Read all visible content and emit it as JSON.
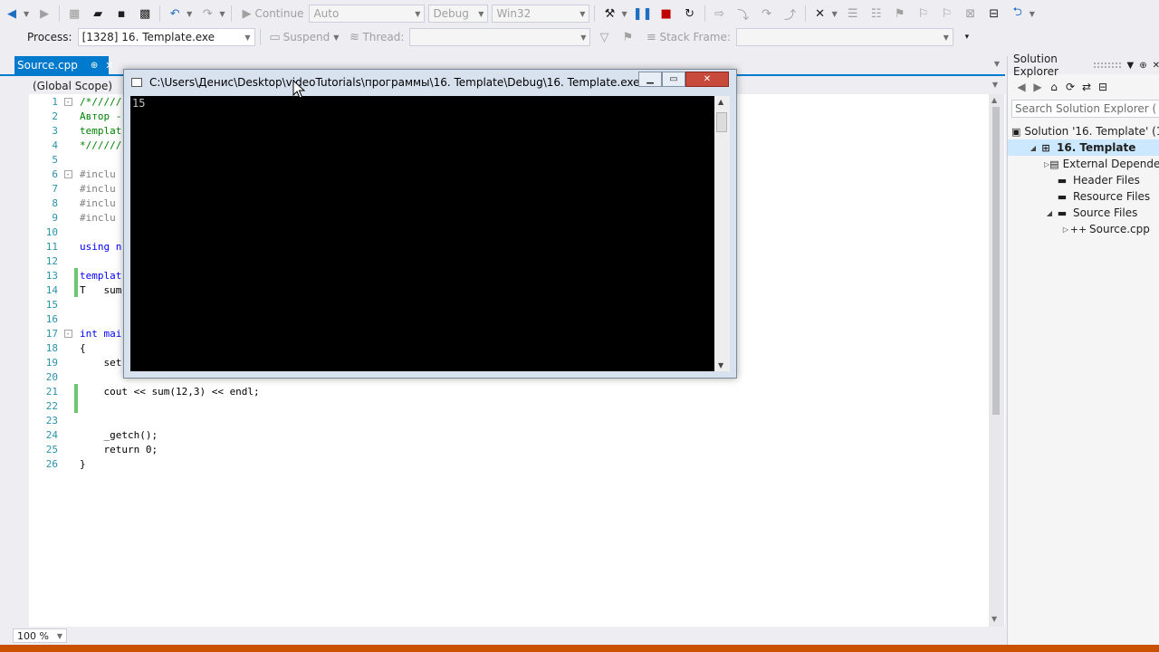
{
  "toolbar": {
    "continue_label": "Continue",
    "solution_config_value": "Auto",
    "build_config_value": "Debug",
    "platform_value": "Win32"
  },
  "debug_toolbar": {
    "process_label": "Process:",
    "process_value": "[1328] 16. Template.exe",
    "suspend_label": "Suspend",
    "thread_label": "Thread:",
    "stack_frame_label": "Stack Frame:"
  },
  "editor": {
    "tab_label": "Source.cpp",
    "scope_label": "(Global Scope)",
    "zoom_level": "100 %",
    "lines": [
      {
        "num": "1",
        "text": "/*/////",
        "cls": "comment",
        "fold": "-"
      },
      {
        "num": "2",
        "text": "Автор -",
        "cls": "comment",
        "fold": ""
      },
      {
        "num": "3",
        "text": "templat",
        "cls": "comment",
        "fold": ""
      },
      {
        "num": "4",
        "text": "*//////",
        "cls": "comment",
        "fold": ""
      },
      {
        "num": "5",
        "text": "",
        "cls": "",
        "fold": ""
      },
      {
        "num": "6",
        "text": "#inclu",
        "cls": "pre",
        "fold": "-"
      },
      {
        "num": "7",
        "text": "#inclu",
        "cls": "pre",
        "fold": ""
      },
      {
        "num": "8",
        "text": "#inclu",
        "cls": "pre",
        "fold": ""
      },
      {
        "num": "9",
        "text": "#inclu",
        "cls": "pre",
        "fold": ""
      },
      {
        "num": "10",
        "text": "",
        "cls": "",
        "fold": ""
      },
      {
        "num": "11",
        "text": "using n",
        "cls": "kw",
        "fold": ""
      },
      {
        "num": "12",
        "text": "",
        "cls": "",
        "fold": ""
      },
      {
        "num": "13",
        "text": "templat",
        "cls": "kw",
        "fold": ""
      },
      {
        "num": "14",
        "text": "T   sum",
        "cls": "",
        "fold": ""
      },
      {
        "num": "15",
        "text": "",
        "cls": "",
        "fold": ""
      },
      {
        "num": "16",
        "text": "",
        "cls": "",
        "fold": ""
      },
      {
        "num": "17",
        "text": "int mai",
        "cls": "kw",
        "fold": "-"
      },
      {
        "num": "18",
        "text": "{",
        "cls": "",
        "fold": ""
      },
      {
        "num": "19",
        "text": "    set",
        "cls": "",
        "fold": ""
      },
      {
        "num": "20",
        "text": "",
        "cls": "",
        "fold": ""
      },
      {
        "num": "21",
        "text": "    cout << sum(12,3) << endl;",
        "cls": "",
        "fold": ""
      },
      {
        "num": "22",
        "text": "",
        "cls": "",
        "fold": ""
      },
      {
        "num": "23",
        "text": "",
        "cls": "",
        "fold": ""
      },
      {
        "num": "24",
        "text": "    _getch();",
        "cls": "",
        "fold": ""
      },
      {
        "num": "25",
        "text": "    return 0;",
        "cls": "",
        "fold": ""
      },
      {
        "num": "26",
        "text": "}",
        "cls": "",
        "fold": ""
      }
    ],
    "changed_lines": [
      "13",
      "14",
      "21",
      "22"
    ]
  },
  "console": {
    "title": "C:\\Users\\Денис\\Desktop\\videoTutorials\\программы\\16. Template\\Debug\\16. Template.exe",
    "output": "15"
  },
  "solution_explorer": {
    "title": "Solution Explorer",
    "search_placeholder": "Search Solution Explorer (",
    "tree": [
      {
        "label": "Solution '16. Template' (1",
        "level": 0,
        "exp": "",
        "icon": "solution-icon",
        "glyph": "▣",
        "selected": false
      },
      {
        "label": "16. Template",
        "level": 1,
        "exp": "◢",
        "icon": "project-icon",
        "glyph": "⊞",
        "selected": true
      },
      {
        "label": "External Dependen",
        "level": 2,
        "exp": "▷",
        "icon": "dependencies-icon",
        "glyph": "▤",
        "selected": false
      },
      {
        "label": "Header Files",
        "level": 2,
        "exp": "",
        "icon": "folder-icon",
        "glyph": "▬",
        "selected": false
      },
      {
        "label": "Resource Files",
        "level": 2,
        "exp": "",
        "icon": "folder-icon",
        "glyph": "▬",
        "selected": false
      },
      {
        "label": "Source Files",
        "level": 2,
        "exp": "◢",
        "icon": "folder-icon",
        "glyph": "▬",
        "selected": false
      },
      {
        "label": "Source.cpp",
        "level": 3,
        "exp": "▷",
        "icon": "cpp-file-icon",
        "glyph": "++",
        "selected": false
      }
    ]
  },
  "colors": {
    "accent": "#007acc",
    "status_bar": "#ca5100",
    "console_bg": "#000000"
  }
}
